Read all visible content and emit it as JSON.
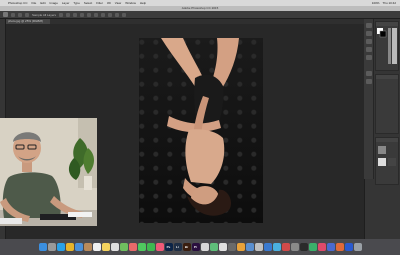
{
  "menubar": {
    "items": [
      "Photoshop CC",
      "File",
      "Edit",
      "Image",
      "Layer",
      "Type",
      "Select",
      "Filter",
      "3D",
      "View",
      "Window",
      "Help"
    ],
    "right": [
      "100%",
      "Thu 10:42"
    ]
  },
  "window": {
    "title": "Adobe Photoshop CC 2015"
  },
  "optionsbar": {
    "mode_label": "Sample All Layers"
  },
  "document": {
    "tab_label": "photo.jpg @ 25% (RGB/8)"
  },
  "dock": {
    "apps": [
      {
        "name": "finder-icon",
        "color": "#3b8fe0",
        "glyph": ""
      },
      {
        "name": "launchpad-icon",
        "color": "#9a9a9a",
        "glyph": ""
      },
      {
        "name": "safari-icon",
        "color": "#2aa1e8",
        "glyph": ""
      },
      {
        "name": "chrome-icon",
        "color": "#e8b42a",
        "glyph": ""
      },
      {
        "name": "mail-icon",
        "color": "#4a90d9",
        "glyph": ""
      },
      {
        "name": "contacts-icon",
        "color": "#b98a5a",
        "glyph": ""
      },
      {
        "name": "calendar-icon",
        "color": "#f0f0f0",
        "glyph": ""
      },
      {
        "name": "notes-icon",
        "color": "#f4d35e",
        "glyph": ""
      },
      {
        "name": "reminders-icon",
        "color": "#e0e0e0",
        "glyph": ""
      },
      {
        "name": "maps-icon",
        "color": "#6fbf5f",
        "glyph": ""
      },
      {
        "name": "photos-icon",
        "color": "#e86a6a",
        "glyph": ""
      },
      {
        "name": "messages-icon",
        "color": "#4fc95f",
        "glyph": ""
      },
      {
        "name": "facetime-icon",
        "color": "#3fb950",
        "glyph": ""
      },
      {
        "name": "music-icon",
        "color": "#f05a78",
        "glyph": ""
      },
      {
        "name": "photoshop-icon",
        "color": "#0b2447",
        "glyph": "Ps"
      },
      {
        "name": "lightroom-icon",
        "color": "#1f2f46",
        "glyph": "Lr"
      },
      {
        "name": "bridge-icon",
        "color": "#3a1e10",
        "glyph": "Br"
      },
      {
        "name": "premiere-icon",
        "color": "#2a0f3f",
        "glyph": "Pr"
      },
      {
        "name": "app-icon-1",
        "color": "#d9d9d9",
        "glyph": ""
      },
      {
        "name": "app-icon-2",
        "color": "#5fbf7a",
        "glyph": ""
      },
      {
        "name": "app-icon-3",
        "color": "#e0e0e0",
        "glyph": ""
      },
      {
        "name": "app-icon-4",
        "color": "#6a6a6a",
        "glyph": ""
      },
      {
        "name": "app-icon-5",
        "color": "#e8a23a",
        "glyph": ""
      },
      {
        "name": "app-icon-6",
        "color": "#5a8fd0",
        "glyph": ""
      },
      {
        "name": "app-icon-7",
        "color": "#c0c0c0",
        "glyph": ""
      },
      {
        "name": "app-icon-8",
        "color": "#3a7ad0",
        "glyph": ""
      },
      {
        "name": "app-icon-9",
        "color": "#4ab0e0",
        "glyph": ""
      },
      {
        "name": "app-icon-10",
        "color": "#d04a4a",
        "glyph": ""
      },
      {
        "name": "app-icon-11",
        "color": "#8a8a8a",
        "glyph": ""
      },
      {
        "name": "app-icon-12",
        "color": "#2a2a2a",
        "glyph": ""
      },
      {
        "name": "app-icon-13",
        "color": "#3ab06a",
        "glyph": ""
      },
      {
        "name": "app-icon-14",
        "color": "#e04a6a",
        "glyph": ""
      },
      {
        "name": "app-icon-15",
        "color": "#4a6ad0",
        "glyph": ""
      },
      {
        "name": "app-icon-16",
        "color": "#e06a3a",
        "glyph": ""
      },
      {
        "name": "app-icon-17",
        "color": "#2a5ad0",
        "glyph": ""
      },
      {
        "name": "trash-icon",
        "color": "#9aa0a6",
        "glyph": ""
      }
    ]
  }
}
